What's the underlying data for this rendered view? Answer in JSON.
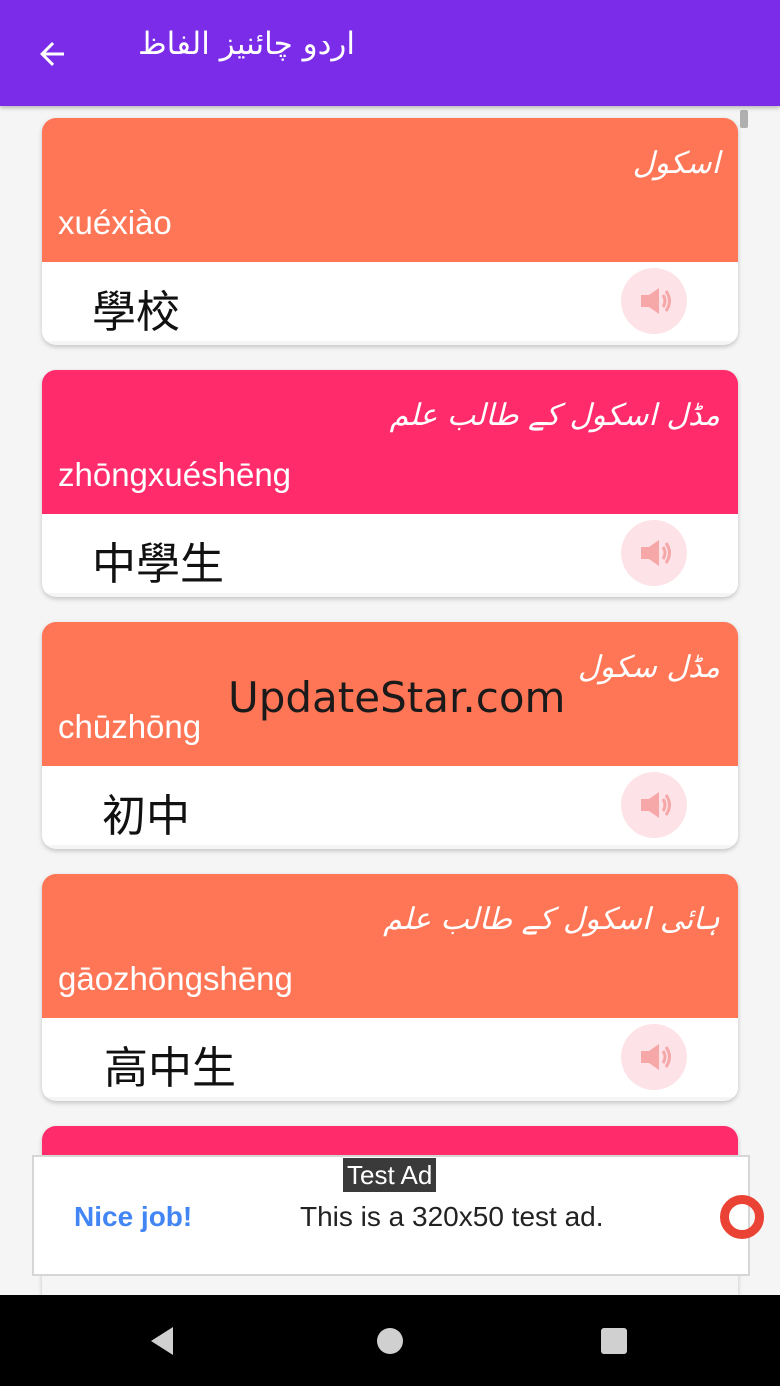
{
  "app_bar": {
    "title": "اردو چائنیز الفاظ",
    "back_icon": "arrow-left-icon",
    "color": "#7a2ce8"
  },
  "cards": [
    {
      "urdu": "اسکول",
      "pinyin": "xuéxiào",
      "chinese": "學校",
      "color": "#ff7656",
      "sound_icon": "speaker-icon"
    },
    {
      "urdu": "مڈل اسکول کے طالب علم",
      "pinyin": "zhōngxuéshēng",
      "chinese": "中學生",
      "color": "#ff2b6b",
      "sound_icon": "speaker-icon"
    },
    {
      "urdu": "مڈل سکول",
      "pinyin": "chūzhōng",
      "chinese": "初中",
      "color": "#ff7656",
      "sound_icon": "speaker-icon"
    },
    {
      "urdu": "ہائی اسکول کے طالب علم",
      "pinyin": "gāozhōngshēng",
      "chinese": "高中生",
      "color": "#ff7656",
      "sound_icon": "speaker-icon"
    }
  ],
  "watermark": "UpdateStar.com",
  "ad": {
    "tag": "Test Ad",
    "headline": "Nice job!",
    "body": "This is a 320x50 test ad."
  },
  "nav": {
    "back_icon": "triangle-back-icon",
    "home_icon": "circle-home-icon",
    "recents_icon": "square-recents-icon"
  }
}
